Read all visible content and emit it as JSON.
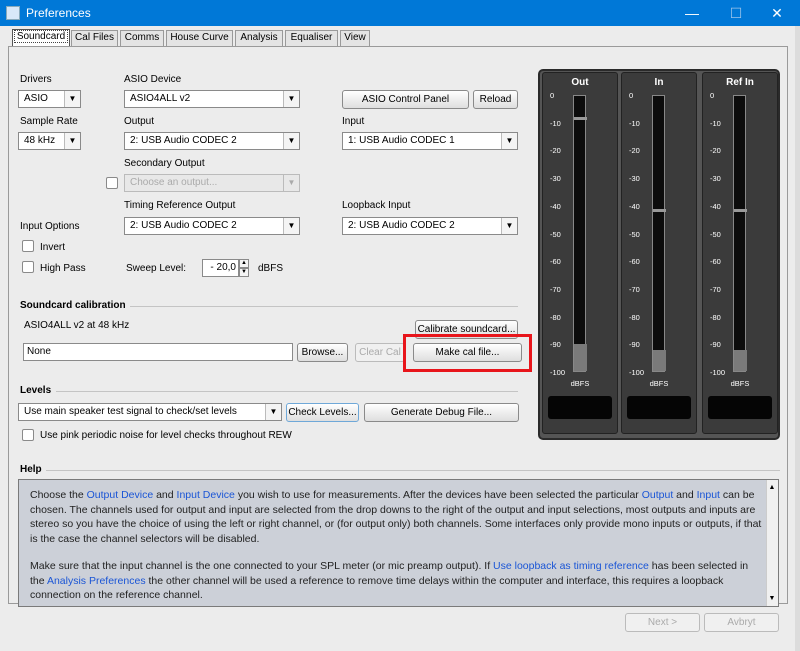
{
  "window": {
    "title": "Preferences",
    "minimize": "—",
    "maximize": "☐",
    "close": "✕"
  },
  "tabs": [
    "Soundcard",
    "Cal Files",
    "Comms",
    "House Curve",
    "Analysis",
    "Equaliser",
    "View"
  ],
  "soundcard": {
    "drivers_label": "Drivers",
    "drivers_value": "ASIO",
    "asio_device_label": "ASIO Device",
    "asio_device_value": "ASIO4ALL v2",
    "asio_control_panel": "ASIO Control Panel",
    "reload": "Reload",
    "sample_rate_label": "Sample Rate",
    "sample_rate_value": "48 kHz",
    "output_label": "Output",
    "output_value": "2: USB Audio CODEC  2",
    "input_label": "Input",
    "input_value": "1: USB Audio CODEC  1",
    "secondary_output_label": "Secondary Output",
    "secondary_output_placeholder": "Choose an output...",
    "timing_ref_label": "Timing Reference Output",
    "timing_ref_value": "2: USB Audio CODEC  2",
    "loopback_label": "Loopback Input",
    "loopback_value": "2: USB Audio CODEC  2",
    "input_options_label": "Input Options",
    "invert_label": "Invert",
    "high_pass_label": "High Pass",
    "sweep_level_label": "Sweep Level:",
    "sweep_level_value": "- 20,0",
    "sweep_level_unit": "dBFS"
  },
  "calibration": {
    "section_title": "Soundcard calibration",
    "status": "ASIO4ALL v2 at 48 kHz",
    "file_value": "None",
    "browse": "Browse...",
    "clear_cal": "Clear Cal",
    "calibrate": "Calibrate soundcard...",
    "make_cal": "Make cal file..."
  },
  "levels": {
    "section_title": "Levels",
    "signal_value": "Use main speaker test signal to check/set levels",
    "check_levels": "Check Levels...",
    "debug_file": "Generate Debug File...",
    "pink_noise_label": "Use pink periodic noise for level checks throughout REW"
  },
  "meters": {
    "titles": [
      "Out",
      "In",
      "Ref In"
    ],
    "scale": [
      "0",
      "-10",
      "-20",
      "-30",
      "-40",
      "-50",
      "-60",
      "-70",
      "-80",
      "-90",
      "-100"
    ],
    "unit": "dBFS",
    "levels_dbfs": [
      -90,
      -92,
      -92
    ],
    "peaks_dbfs": [
      -8,
      -41,
      -41
    ]
  },
  "help": {
    "section_title": "Help",
    "p1": [
      "Choose the ",
      "Output Device",
      " and ",
      "Input Device",
      " you wish to use for measurements. After the devices have been selected the particular ",
      "Output",
      " and ",
      "Input",
      " can be chosen. The channels used for output and input are selected from the drop downs to the right of the output and input selections, most outputs and inputs are stereo so you have the choice of using the left or right channel, or (for output only) both channels. Some interfaces only provide mono inputs or outputs, if that is the case the channel selectors will be disabled."
    ],
    "p2": [
      "Make sure that the input channel is the one connected to your SPL meter (or mic preamp output). If ",
      "Use loopback as timing reference",
      " has been selected in the ",
      "Analysis Preferences",
      " the other channel will be used a reference to remove time delays within the computer and interface, this requires a loopback connection on the reference channel."
    ]
  },
  "footer": {
    "next": "Next >",
    "cancel": "Avbryt"
  },
  "highlight_color": "#e8151b"
}
